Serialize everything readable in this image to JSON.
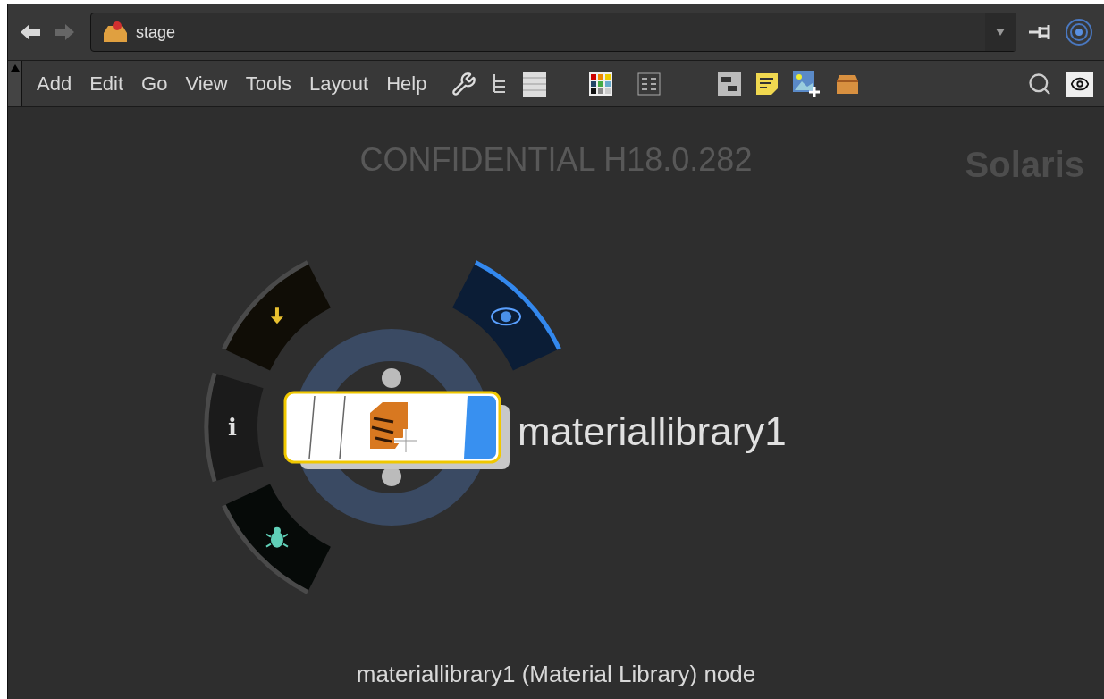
{
  "path_bar": {
    "value": "stage"
  },
  "menu": [
    "Add",
    "Edit",
    "Go",
    "View",
    "Tools",
    "Layout",
    "Help"
  ],
  "network": {
    "watermark": "CONFIDENTIAL H18.0.282",
    "context_label": "Solaris",
    "node": {
      "name": "materiallibrary1",
      "selected": true,
      "display_flag": true
    },
    "radial_menu": [
      {
        "kind": "arrow",
        "selected": false
      },
      {
        "kind": "info",
        "selected": false,
        "label": "i"
      },
      {
        "kind": "bug",
        "selected": false
      },
      {
        "kind": "eye",
        "selected": true
      }
    ]
  },
  "status_bar": "materiallibrary1 (Material Library) node"
}
